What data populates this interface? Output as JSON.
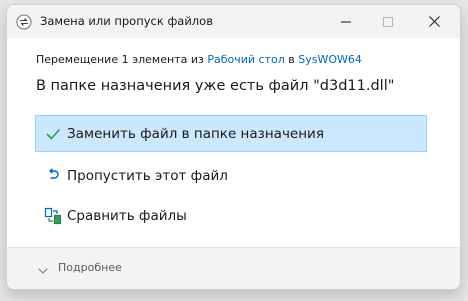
{
  "window": {
    "title": "Замена или пропуск файлов"
  },
  "titlebar": {
    "minimize_icon": "minimize-icon",
    "maximize_icon": "maximize-icon",
    "close_icon": "close-icon"
  },
  "subtitle": {
    "prefix": "Перемещение 1 элемента из ",
    "source": "Рабочий стол",
    "middle": " в ",
    "destination": "SysWOW64"
  },
  "message": "В папке назначения уже есть файл \"d3d11.dll\"",
  "options": [
    {
      "label": "Заменить файл в папке назначения",
      "icon": "checkmark-icon",
      "selected": true
    },
    {
      "label": "Пропустить этот файл",
      "icon": "skip-icon",
      "selected": false
    },
    {
      "label": "Сравнить файлы",
      "icon": "compare-icon",
      "selected": false
    }
  ],
  "footer": {
    "details_label": "Подробнее"
  },
  "colors": {
    "accent": "#0067c0",
    "selection_bg": "#cce8ff",
    "selection_border": "#99d1ff"
  }
}
